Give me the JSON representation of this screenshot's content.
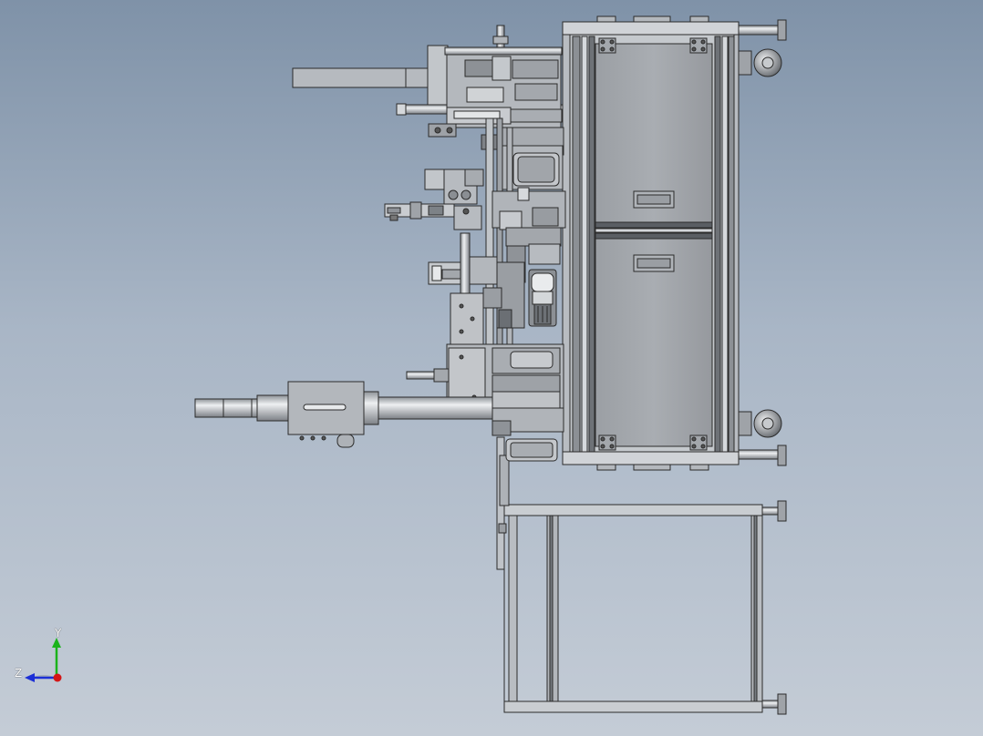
{
  "viewport": {
    "background_top": "#7f92a8",
    "background_bottom": "#c4ccd6"
  },
  "triad": {
    "y_label": "Y",
    "z_label": "Z",
    "y_color": "#1bb31b",
    "z_color": "#1c2fd6",
    "x_color": "#d41616"
  },
  "model": {
    "line_color": "#2b2b2b",
    "metal_light": "#c9cdd2",
    "metal_mid": "#a7acb2",
    "metal_dark": "#7d8287"
  }
}
